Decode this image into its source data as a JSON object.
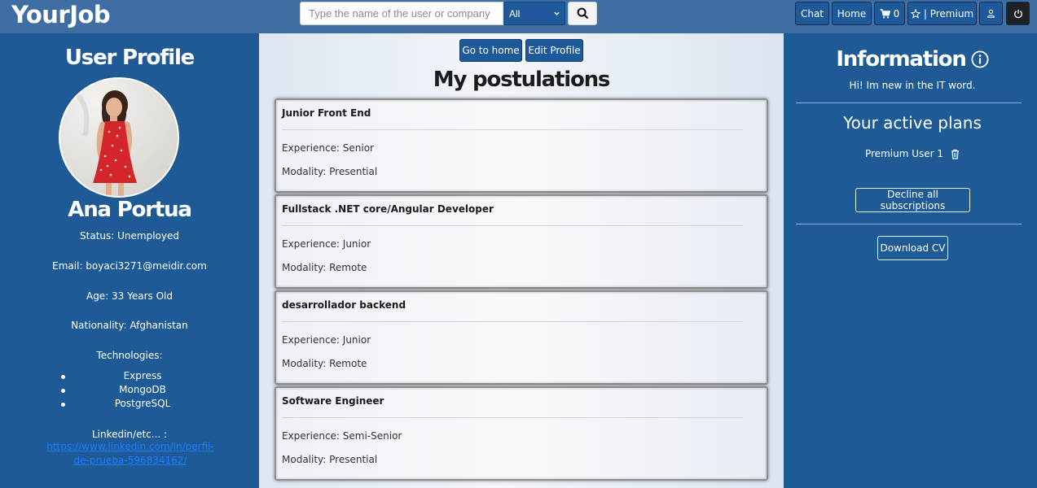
{
  "header": {
    "logo": "YourJob",
    "search_placeholder": "Type the name of the user or company",
    "search_filter": "All",
    "nav": {
      "chat": "Chat",
      "home": "Home",
      "cart_count": "0",
      "premium": "| Premium"
    }
  },
  "profile": {
    "title": "User Profile",
    "name": "Ana Portua",
    "status": "Status: Unemployed",
    "email": "Email: boyaci3271@meidir.com",
    "age": "Age: 33 Years Old",
    "nationality": "Nationality: Afghanistan",
    "technologies_label": "Technologies:",
    "technologies": [
      "Express",
      "MongoDB",
      "PostgreSQL"
    ],
    "linkedin_label": "Linkedin/etc... :",
    "linkedin_url": "https://www.linkedin.com/in/perfil-de-prueba-596834162/"
  },
  "main": {
    "go_home": "Go to home",
    "edit_profile": "Edit Profile",
    "title": "My postulations",
    "postulations": [
      {
        "job": "Junior Front End",
        "experience": "Experience: Senior",
        "modality": "Modality: Presential"
      },
      {
        "job": "Fullstack .NET core/Angular Developer",
        "experience": "Experience: Junior",
        "modality": "Modality: Remote"
      },
      {
        "job": "desarrollador backend",
        "experience": "Experience: Junior",
        "modality": "Modality: Remote"
      },
      {
        "job": "Software Engineer",
        "experience": "Experience: Semi-Senior",
        "modality": "Modality: Presential"
      }
    ]
  },
  "info": {
    "title": "Information",
    "bio": "Hi! Im new in the IT word.",
    "plans_title": "Your active plans",
    "plan": "Premium User 1",
    "decline": "Decline all subscriptions",
    "download_cv": "Download CV"
  },
  "colors": {
    "panel_blue": "#1d5a96",
    "header_blue": "#3e6ea3",
    "button_blue": "#1e5a9a",
    "link_blue": "#1e7bff"
  }
}
